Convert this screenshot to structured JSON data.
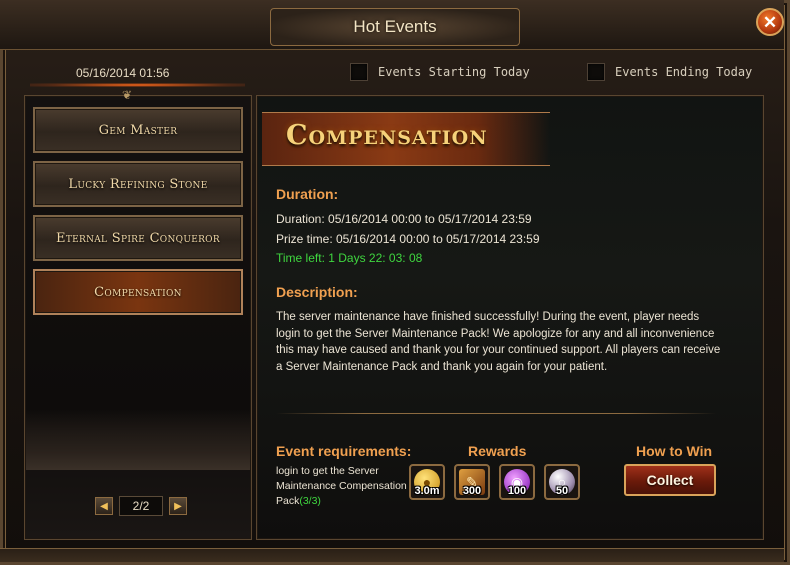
{
  "window": {
    "title": "Hot Events",
    "close_label": "✕"
  },
  "header": {
    "datetime": "05/16/2014 01:56",
    "filters": [
      {
        "label": "Events Starting Today",
        "checked": false
      },
      {
        "label": "Events Ending Today",
        "checked": false
      }
    ]
  },
  "sidebar": {
    "items": [
      {
        "label": "Gem Master"
      },
      {
        "label": "Lucky Refining Stone"
      },
      {
        "label": "Eternal Spire Conqueror"
      },
      {
        "label": "Compensation",
        "active": true
      }
    ],
    "pager": {
      "prev": "◀",
      "page": "2/2",
      "next": "▶"
    }
  },
  "event": {
    "title": "Compensation",
    "duration_heading": "Duration:",
    "duration_line": "Duration: 05/16/2014 00:00 to 05/17/2014 23:59",
    "prize_line": "Prize time: 05/16/2014 00:00 to 05/17/2014 23:59",
    "time_left": "Time left: 1 Days  22: 03: 08",
    "description_heading": "Description:",
    "description": "The server maintenance have finished successfully!  During the event, player needs login to get the Server Maintenance Pack!  We apologize for any and all inconvenience this may have caused and thank you for your continued support. All players can receive a  Server Maintenance Pack and thank you again for your patient.",
    "requirements_heading": "Event requirements:",
    "requirement_text": "login to get the Server Maintenance Compensation Pack",
    "requirement_count": "(3/3)",
    "rewards_heading": "Rewards",
    "rewards": [
      {
        "icon": "gold-coin-icon",
        "quantity": "3.0m"
      },
      {
        "icon": "scroll-book-icon",
        "quantity": "300"
      },
      {
        "icon": "purple-orb-icon",
        "quantity": "100"
      },
      {
        "icon": "pearl-icon",
        "quantity": "50"
      }
    ],
    "how_to_win_heading": "How to Win",
    "collect_label": "Collect"
  }
}
